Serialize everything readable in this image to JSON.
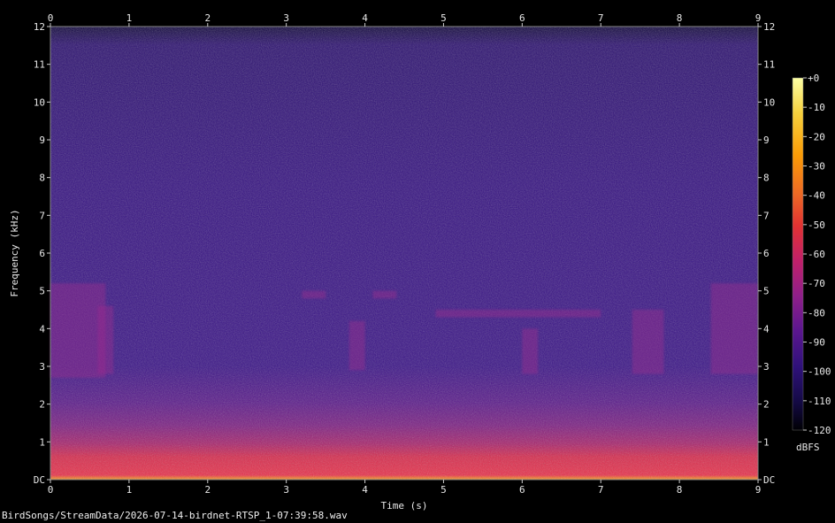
{
  "chart_data": {
    "type": "heatmap",
    "title": "",
    "xlabel": "Time (s)",
    "ylabel": "Frequency (kHz)",
    "xlim": [
      0,
      9
    ],
    "ylim": [
      0,
      12
    ],
    "x_ticks": [
      "0",
      "1",
      "2",
      "3",
      "4",
      "5",
      "6",
      "7",
      "8",
      "9"
    ],
    "y_ticks": [
      "DC",
      "1",
      "2",
      "3",
      "4",
      "5",
      "6",
      "7",
      "8",
      "9",
      "10",
      "11",
      "12"
    ],
    "colorbar": {
      "label": "dBFS",
      "range": [
        -120,
        0
      ],
      "ticks": [
        "+0",
        "-10",
        "-20",
        "-30",
        "-40",
        "-50",
        "-60",
        "-70",
        "-80",
        "-90",
        "-100",
        "-110",
        "-120"
      ]
    },
    "colors": {
      "background": "#000000",
      "text": "#e8e8e8",
      "colormap": [
        "#000004",
        "#1b0c41",
        "#4a0c6b",
        "#781c6d",
        "#a52c60",
        "#cf4446",
        "#ed6925",
        "#fb9b06",
        "#f7d13d",
        "#fcffa4"
      ]
    },
    "bird_call_events": [
      {
        "t_start": 0.0,
        "t_end": 0.7,
        "f_low": 2.7,
        "f_high": 5.2
      },
      {
        "t_start": 0.6,
        "t_end": 0.8,
        "f_low": 2.8,
        "f_high": 4.6
      },
      {
        "t_start": 3.2,
        "t_end": 3.5,
        "f_low": 4.8,
        "f_high": 5.0
      },
      {
        "t_start": 3.8,
        "t_end": 4.0,
        "f_low": 2.9,
        "f_high": 4.2
      },
      {
        "t_start": 4.1,
        "t_end": 4.4,
        "f_low": 4.8,
        "f_high": 5.0
      },
      {
        "t_start": 4.9,
        "t_end": 7.0,
        "f_low": 4.3,
        "f_high": 4.5
      },
      {
        "t_start": 6.0,
        "t_end": 6.2,
        "f_low": 2.8,
        "f_high": 4.0
      },
      {
        "t_start": 7.4,
        "t_end": 7.8,
        "f_low": 2.8,
        "f_high": 4.5
      },
      {
        "t_start": 8.4,
        "t_end": 9.0,
        "f_low": 2.8,
        "f_high": 5.2
      }
    ]
  },
  "footer": {
    "file_path": "BirdSongs/StreamData/2026-07-14-birdnet-RTSP_1-07:39:58.wav"
  }
}
